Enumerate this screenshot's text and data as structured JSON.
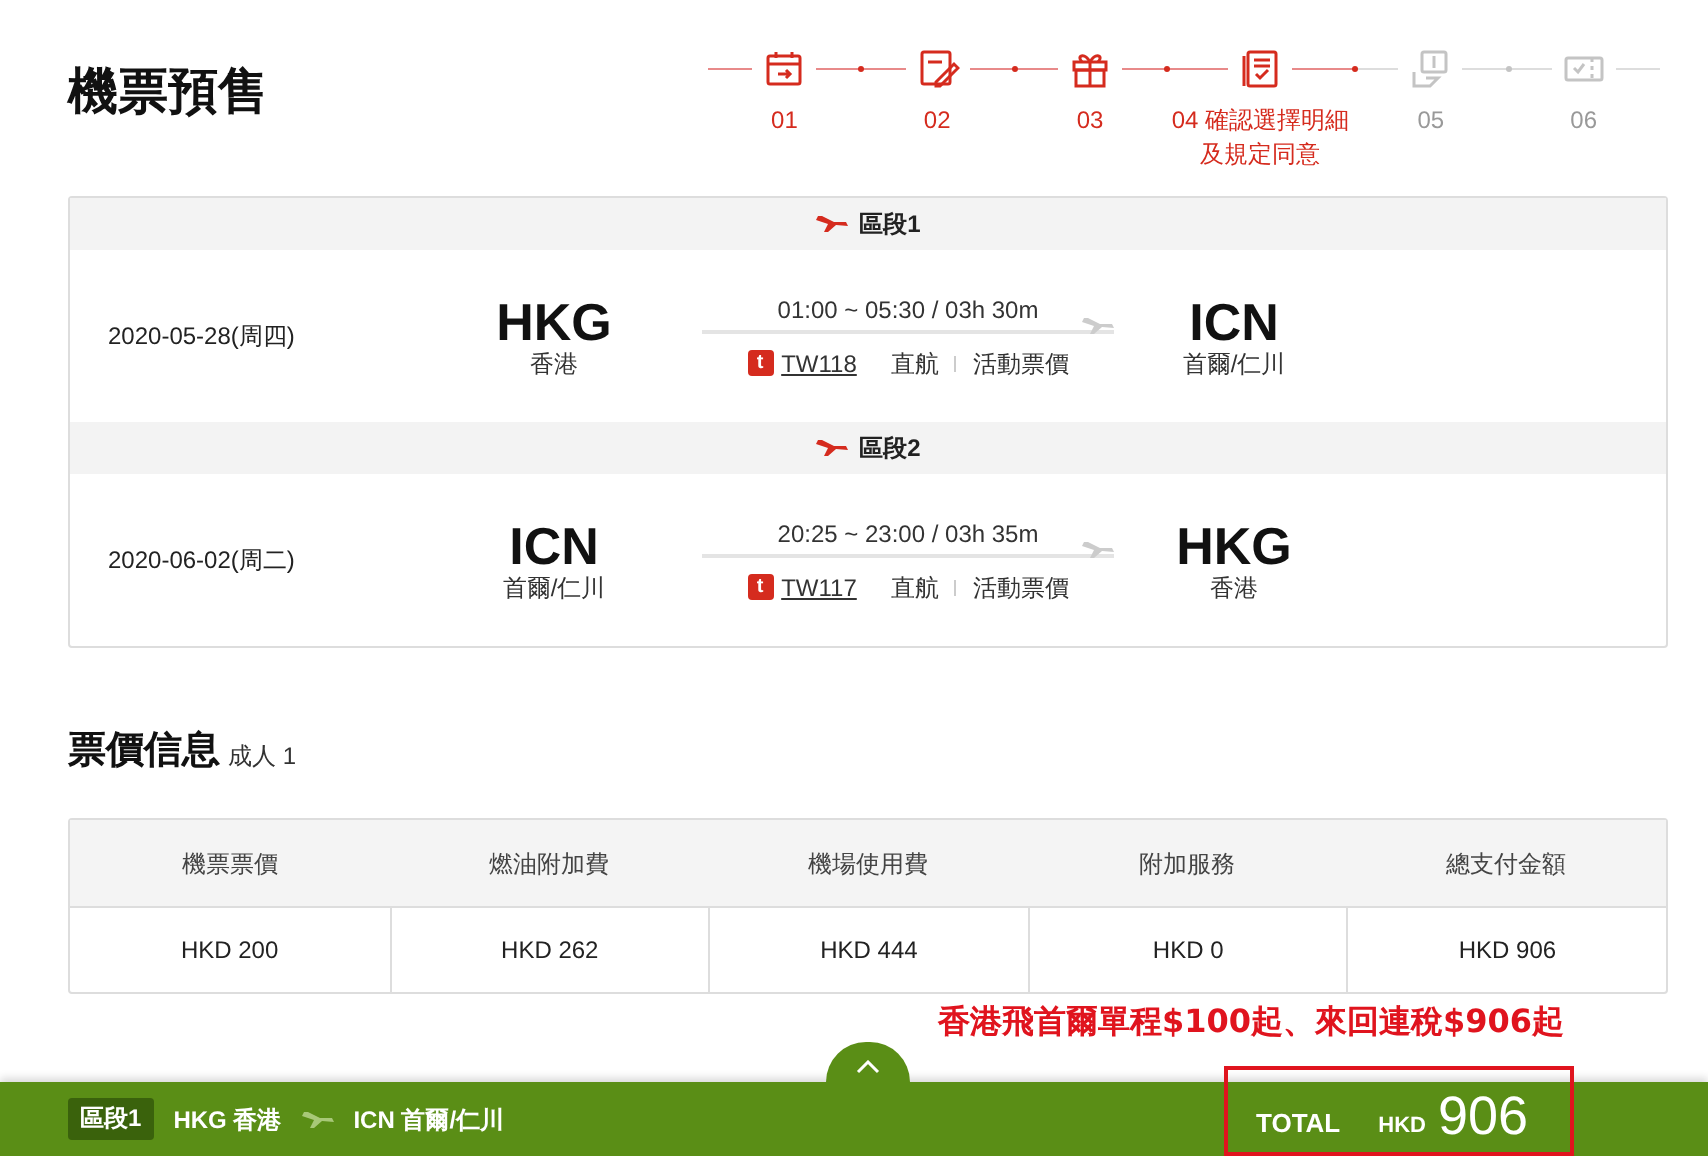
{
  "page_title": "機票預售",
  "steps": [
    {
      "number": "01",
      "completed": true
    },
    {
      "number": "02",
      "completed": true
    },
    {
      "number": "03",
      "completed": true
    },
    {
      "number": "04",
      "label": "確認選擇明細及規定同意",
      "completed": true
    },
    {
      "number": "05",
      "completed": false
    },
    {
      "number": "06",
      "completed": false
    }
  ],
  "segments": [
    {
      "title": "區段1",
      "date": "2020-05-28(周四)",
      "origin_code": "HKG",
      "origin_city": "香港",
      "time": "01:00 ~ 05:30 / 03h 30m",
      "airline_logo": "t",
      "flight_number": "TW118",
      "flight_type": "直航",
      "fare_type": "活動票價",
      "dest_code": "ICN",
      "dest_city": "首爾/仁川"
    },
    {
      "title": "區段2",
      "date": "2020-06-02(周二)",
      "origin_code": "ICN",
      "origin_city": "首爾/仁川",
      "time": "20:25 ~ 23:00 / 03h 35m",
      "airline_logo": "t",
      "flight_number": "TW117",
      "flight_type": "直航",
      "fare_type": "活動票價",
      "dest_code": "HKG",
      "dest_city": "香港"
    }
  ],
  "price_section": {
    "title": "票價信息",
    "passengers": "成人 1",
    "columns": [
      "機票票價",
      "燃油附加費",
      "機場使用費",
      "附加服務",
      "總支付金額"
    ],
    "values": [
      "HKD 200",
      "HKD 262",
      "HKD 444",
      "HKD 0",
      "HKD 906"
    ]
  },
  "promo_annotation": "香港飛首爾單程$100起、來回連稅$906起",
  "footer": {
    "segment_badge": "區段1",
    "origin": "HKG 香港",
    "destination": "ICN 首爾/仁川",
    "total_label": "TOTAL",
    "currency": "HKD",
    "total": "906"
  }
}
